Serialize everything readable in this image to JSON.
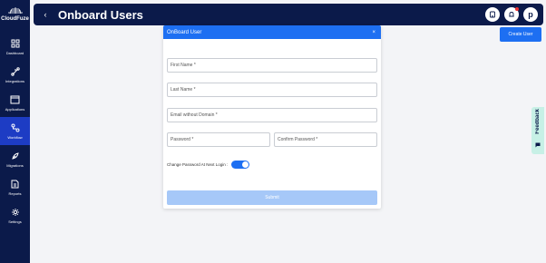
{
  "brand": {
    "name": "CloudFuze"
  },
  "sidebar": {
    "items": [
      {
        "label": "Dashboard",
        "icon": "dashboard-icon"
      },
      {
        "label": "Integrations",
        "icon": "integrations-icon"
      },
      {
        "label": "Applications",
        "icon": "applications-icon"
      },
      {
        "label": "Workflow",
        "icon": "workflow-icon",
        "active": true
      },
      {
        "label": "Migrations",
        "icon": "migrations-icon"
      },
      {
        "label": "Reports",
        "icon": "reports-icon"
      },
      {
        "label": "Settings",
        "icon": "settings-icon"
      }
    ]
  },
  "header": {
    "back_glyph": "‹",
    "title": "Onboard Users",
    "avatar_initial": "p"
  },
  "actions": {
    "create_user": "Create User"
  },
  "feedback": {
    "label": "Feedback"
  },
  "modal": {
    "title": "OnBoard User",
    "close_glyph": "×",
    "fields": {
      "first_name": "First Name *",
      "last_name": "Last Name *",
      "email": "Email without Domain *",
      "password": "Password *",
      "confirm_password": "Confirm Password *"
    },
    "toggle": {
      "label": "Change Password At Next Login :",
      "on": true
    },
    "submit": "Submit"
  },
  "colors": {
    "navy": "#0b1a4a",
    "primary": "#1d6ff2",
    "active_nav": "#1d3cc4",
    "submit_disabled": "#a6c8f8",
    "feedback_bg": "#c7f0e6"
  }
}
